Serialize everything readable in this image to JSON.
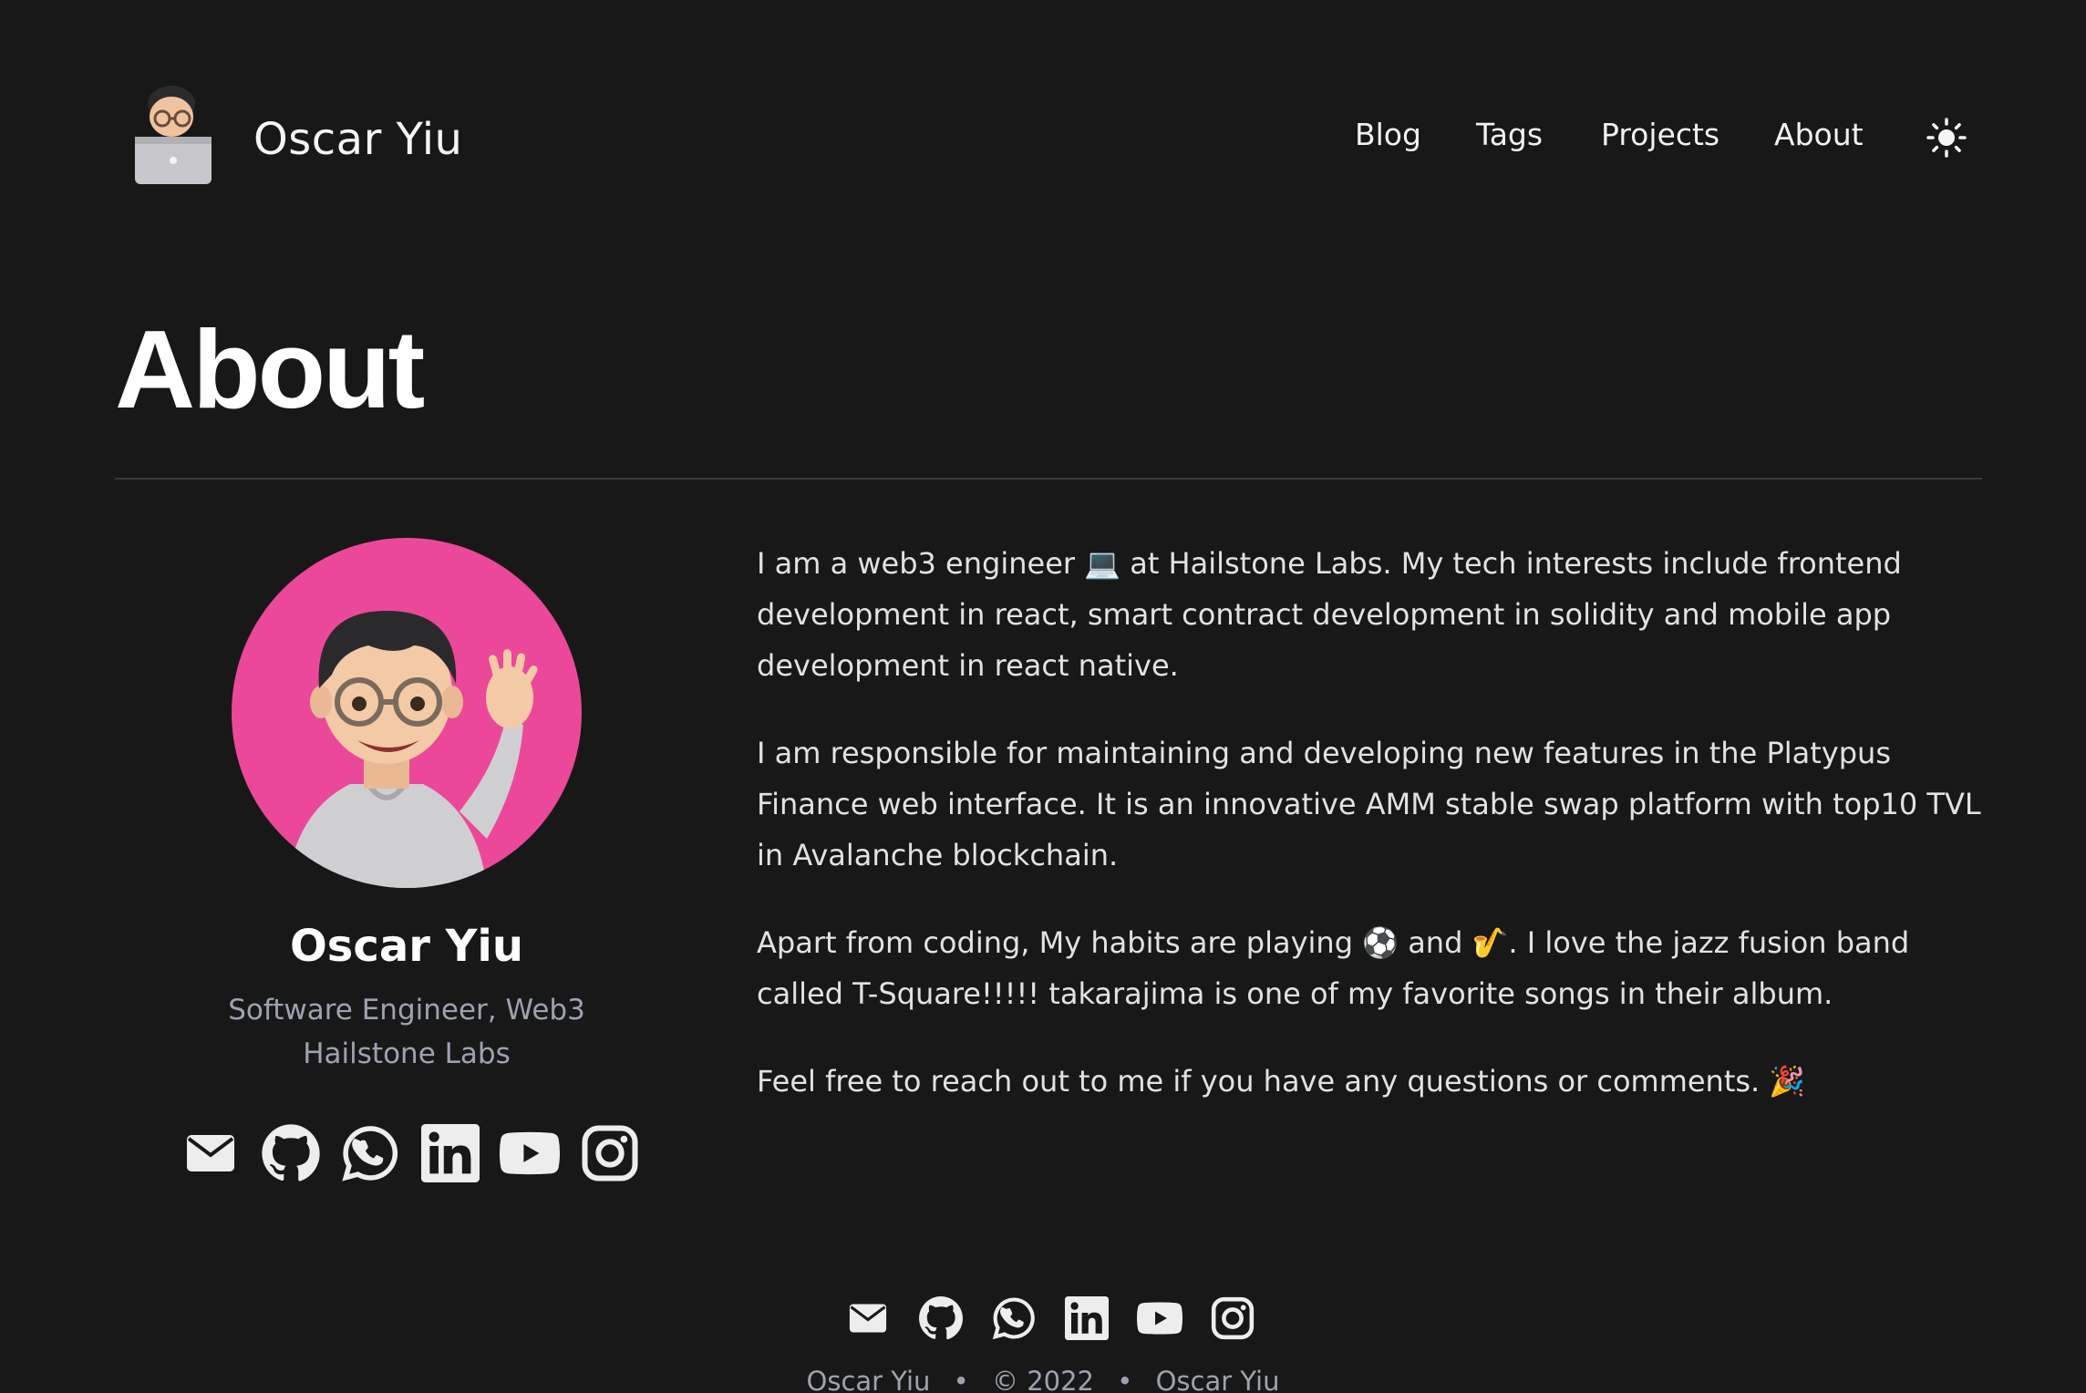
{
  "header": {
    "site_title": "Oscar Yiu",
    "nav": [
      {
        "label": "Blog"
      },
      {
        "label": "Tags"
      },
      {
        "label": "Projects"
      },
      {
        "label": "About"
      }
    ],
    "theme_toggle_icon": "sun-icon"
  },
  "page_title": "About",
  "profile": {
    "name": "Oscar Yiu",
    "role": "Software Engineer, Web3",
    "company": "Hailstone Labs",
    "socials": [
      "mail-icon",
      "github-icon",
      "whatsapp-icon",
      "linkedin-icon",
      "youtube-icon",
      "instagram-icon"
    ],
    "avatar_bg": "#ec4899"
  },
  "bio": {
    "p1_a": "I am a web3 engineer",
    "p1_b": "at Hailstone Labs. My tech interests include frontend development in react, smart contract development in solidity and mobile app development in react native.",
    "p2": "I am responsible for maintaining and developing new features in the Platypus Finance web interface. It is an innovative AMM stable swap platform with top10 TVL in Avalanche blockchain.",
    "p3_a": "Apart from coding, My habits are playing",
    "p3_b": "and",
    "p3_c": ". I love the jazz fusion band called T-Square!!!!! takarajima is one of my favorite songs in their album.",
    "p4": "Feel free to reach out to me if you have any questions or comments."
  },
  "footer": {
    "author": "Oscar Yiu",
    "copyright": "© 2022",
    "site": "Oscar Yiu",
    "separator": "•"
  },
  "colors": {
    "background": "#181818",
    "text": "#ededed",
    "muted": "#9ca3af",
    "accent": "#ec4899"
  }
}
